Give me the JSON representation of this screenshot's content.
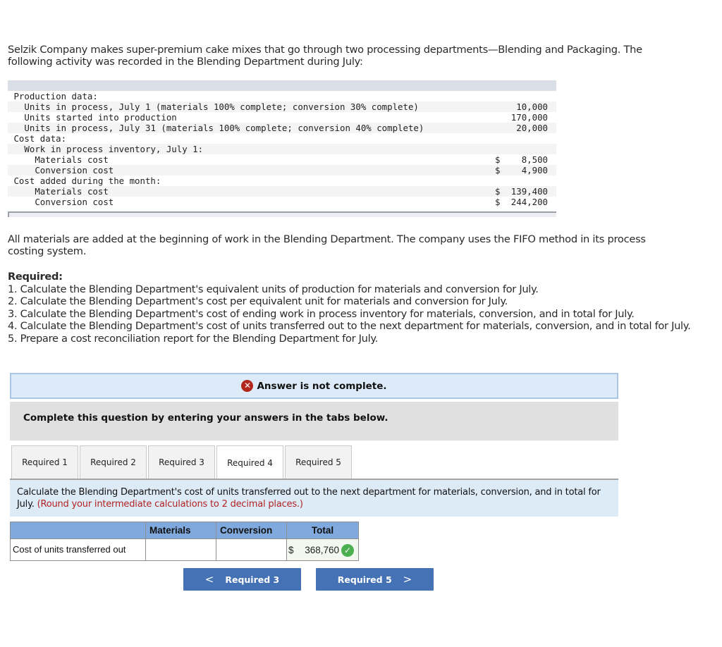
{
  "intro": "Selzik Company makes super-premium cake mixes that go through two processing departments—Blending and Packaging. The following activity was recorded in the Blending Department during July:",
  "data_table": {
    "rows": [
      {
        "label": "Production data:",
        "indent": 1,
        "dollar": "",
        "value": ""
      },
      {
        "label": "Units in process, July 1 (materials 100% complete; conversion 30% complete)",
        "indent": 3,
        "dollar": "",
        "value": "10,000"
      },
      {
        "label": "Units started into production",
        "indent": 3,
        "dollar": "",
        "value": "170,000"
      },
      {
        "label": "Units in process, July 31 (materials 100% complete; conversion 40% complete)",
        "indent": 3,
        "dollar": "",
        "value": "20,000"
      },
      {
        "label": "Cost data:",
        "indent": 1,
        "dollar": "",
        "value": ""
      },
      {
        "label": "Work in process inventory, July 1:",
        "indent": 3,
        "dollar": "",
        "value": ""
      },
      {
        "label": "Materials cost",
        "indent": 5,
        "dollar": "$",
        "value": "8,500"
      },
      {
        "label": "Conversion cost",
        "indent": 5,
        "dollar": "$",
        "value": "4,900"
      },
      {
        "label": "Cost added during the month:",
        "indent": 1,
        "dollar": "",
        "value": ""
      },
      {
        "label": "Materials cost",
        "indent": 5,
        "dollar": "$",
        "value": "139,400"
      },
      {
        "label": "Conversion cost",
        "indent": 5,
        "dollar": "$",
        "value": "244,200"
      }
    ]
  },
  "paragraph2": "All materials are added at the beginning of work in the Blending Department. The company uses the FIFO method in its process costing system.",
  "required": {
    "heading": "Required:",
    "items": [
      "1. Calculate the Blending Department's equivalent units of production for materials and conversion for July.",
      "2. Calculate the Blending Department's cost per equivalent unit for materials and conversion for July.",
      "3. Calculate the Blending Department's cost of ending work in process inventory for materials, conversion, and in total for July.",
      "4. Calculate the Blending Department's cost of units transferred out to the next department for materials, conversion, and in total for July.",
      "5. Prepare a cost reconciliation report for the Blending Department for July."
    ]
  },
  "status": {
    "icon": "x-circle-icon",
    "text": "Answer is not complete."
  },
  "instruction": "Complete this question by entering your answers in the tabs below.",
  "tabs": [
    {
      "label": "Required 1",
      "active": false
    },
    {
      "label": "Required 2",
      "active": false
    },
    {
      "label": "Required 3",
      "active": false
    },
    {
      "label": "Required 4",
      "active": true
    },
    {
      "label": "Required 5",
      "active": false
    }
  ],
  "panel": {
    "question": "Calculate the Blending Department's cost of units transferred out to the next department for materials, conversion, and in total for July.",
    "note": "(Round your intermediate calculations to 2 decimal places.)"
  },
  "answer_table": {
    "headers": [
      "",
      "Materials",
      "Conversion",
      "Total"
    ],
    "row_label": "Cost of units transferred out",
    "materials_value": "",
    "conversion_value": "",
    "total_dollar": "$",
    "total_value": "368,760",
    "total_status": "correct"
  },
  "nav": {
    "prev_label": "Required 3",
    "next_label": "Required 5"
  },
  "colors": {
    "tab_panel_bg": "#ddebf7",
    "table_header_bg": "#80a9de",
    "nav_button_bg": "#4472b4",
    "error_icon": "#b3261e",
    "check_icon": "#4caf50",
    "note_red": "#b22222"
  }
}
